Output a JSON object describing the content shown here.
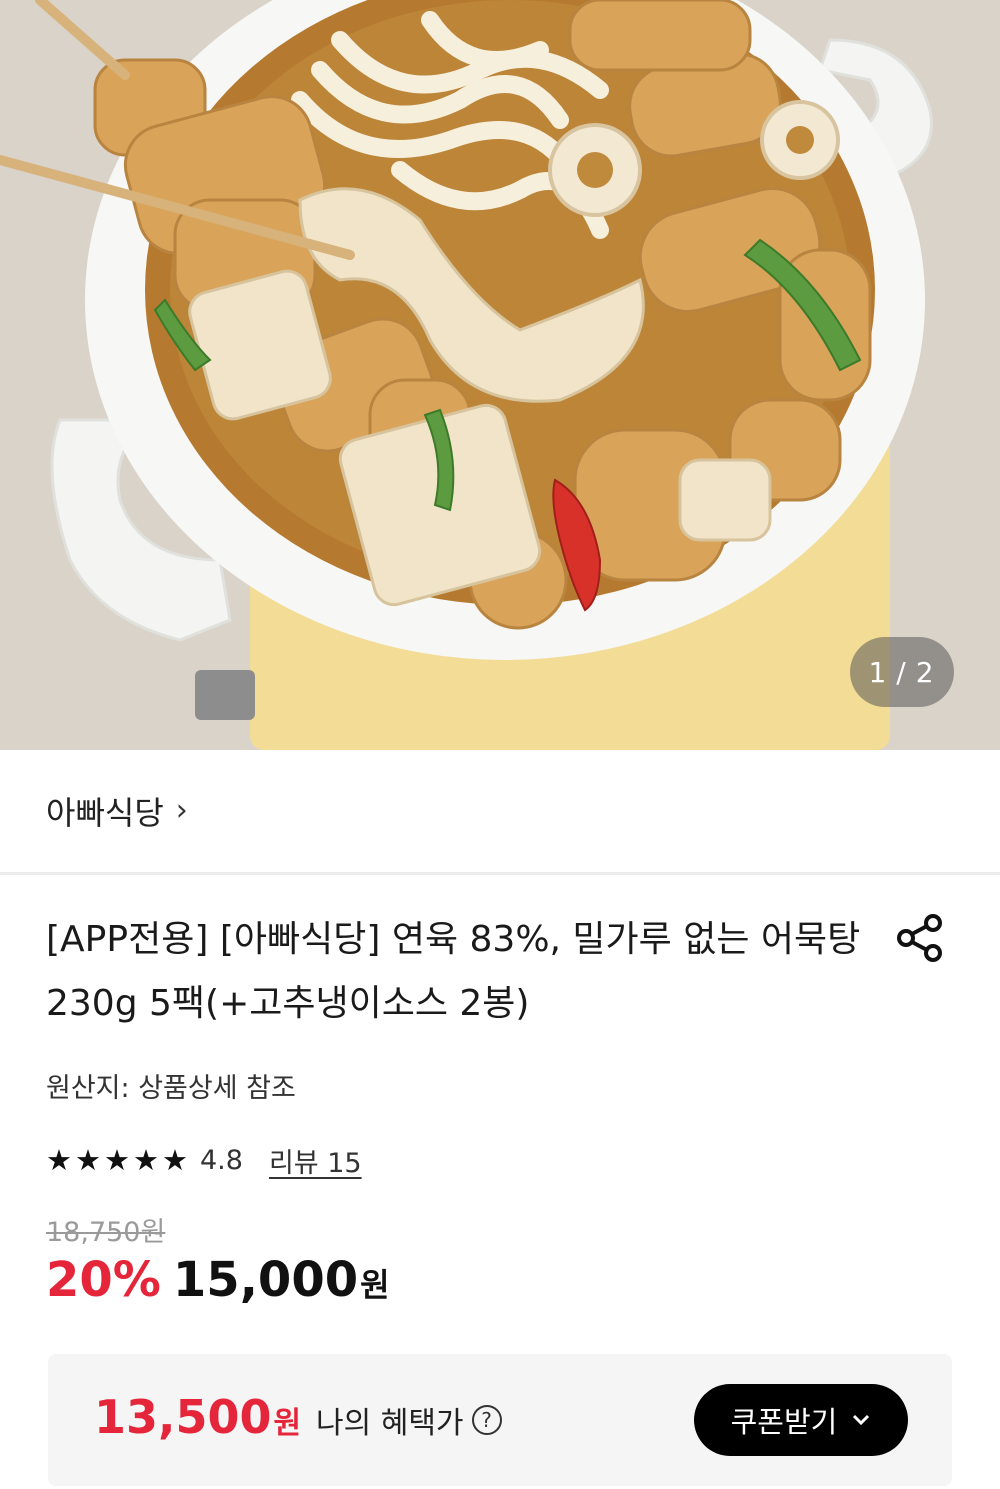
{
  "hero": {
    "pager_current": "1",
    "pager_separator": "/",
    "pager_total": "2"
  },
  "brand": {
    "name": "아빠식당",
    "chevron": "›"
  },
  "product": {
    "title": "[APP전용] [아빠식당] 연육 83%, 밀가루 없는 어묵탕 230g 5팩(+고추냉이소스 2봉)",
    "origin": "원산지: 상품상세 참조",
    "rating_value": "4.8",
    "rating_stars": 5,
    "review_link": "리뷰 15",
    "original_price": "18,750원",
    "discount_rate": "20%",
    "sale_price": "15,000",
    "currency": "원"
  },
  "benefit": {
    "amount": "13,500",
    "currency": "원",
    "label": "나의 혜택가",
    "help_icon": "?",
    "coupon_button": "쿠폰받기"
  },
  "colors": {
    "accent_red": "#e5253a",
    "button_black": "#000000",
    "card_bg": "#f5f5f5"
  },
  "icons": [
    "share-icon",
    "star-icon",
    "question-circle-icon",
    "chevron-down-icon",
    "chevron-right-icon"
  ]
}
